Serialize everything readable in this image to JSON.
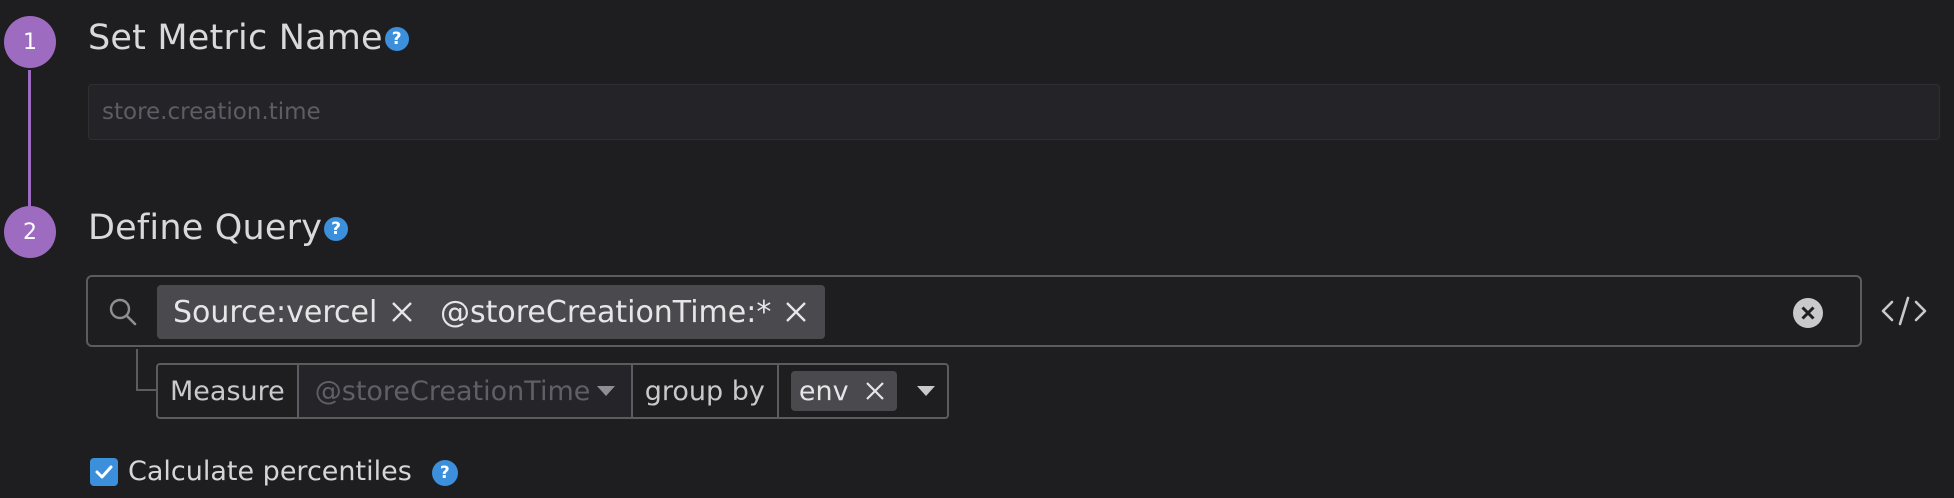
{
  "steps": [
    {
      "number": "1",
      "title": "Set Metric Name"
    },
    {
      "number": "2",
      "title": "Define Query"
    }
  ],
  "help_glyph": "?",
  "metric_name": {
    "placeholder": "store.creation.time",
    "value": ""
  },
  "query": {
    "chips": [
      {
        "label": "Source:vercel"
      },
      {
        "label": "@storeCreationTime:*"
      }
    ]
  },
  "measure": {
    "label": "Measure",
    "placeholder": "@storeCreationTime",
    "group_by_label": "group by",
    "group_by_tags": [
      "env"
    ]
  },
  "percentiles": {
    "label": "Calculate percentiles",
    "checked": true
  },
  "colors": {
    "accent_purple": "#9d6cc1",
    "accent_blue": "#3b8fdb",
    "background": "#1e1e21"
  },
  "icons": [
    "search-icon",
    "close-icon",
    "clear-circle-icon",
    "code-icon",
    "help-icon",
    "check-icon",
    "caret-down-icon"
  ]
}
